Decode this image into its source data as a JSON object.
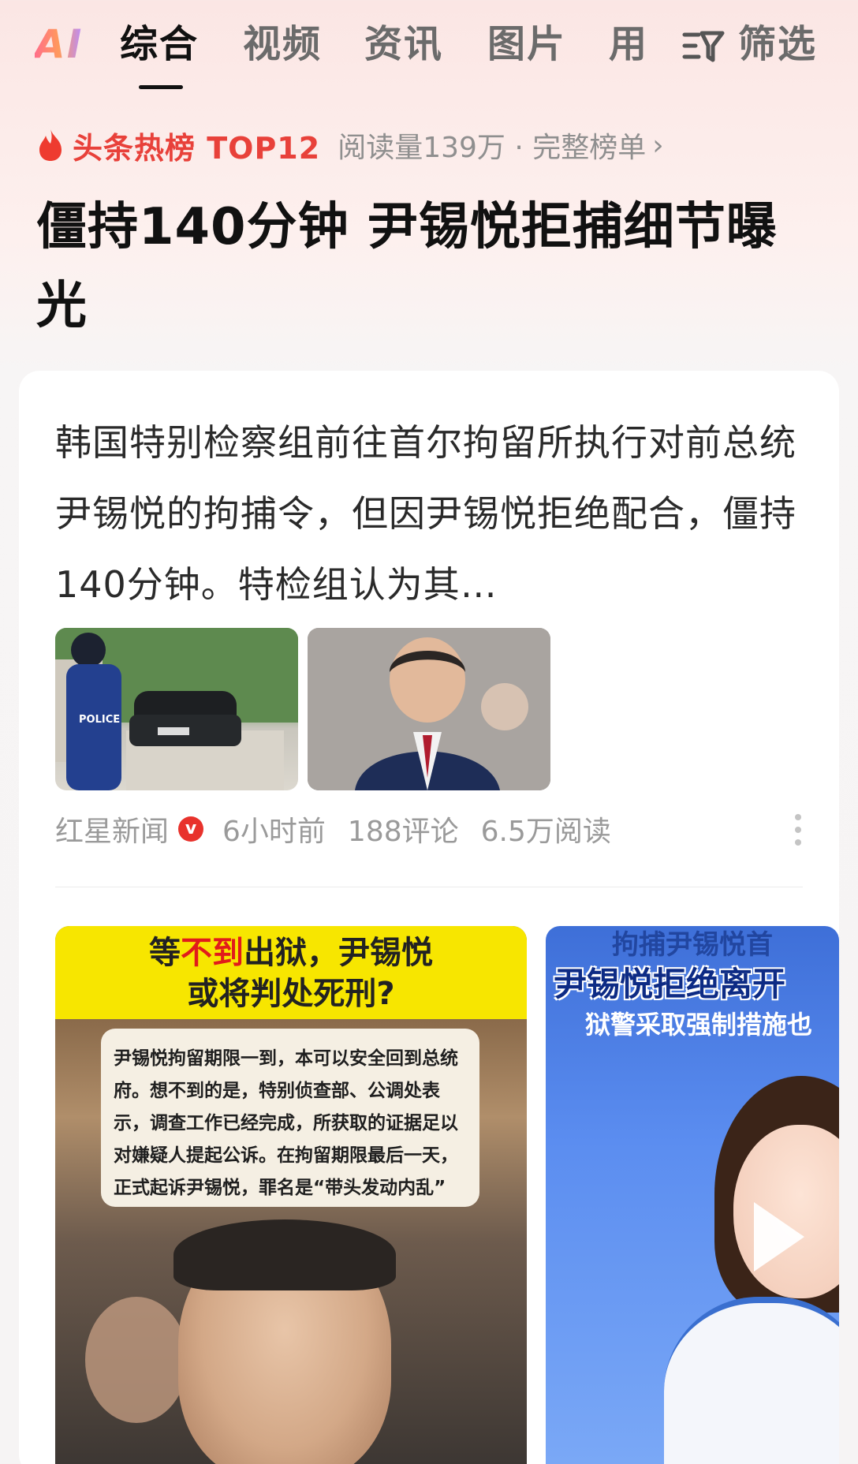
{
  "tabs": {
    "ai": "AI",
    "items": [
      "综合",
      "视频",
      "资讯",
      "图片",
      "用"
    ],
    "active_index": 0,
    "filter_label": "筛选"
  },
  "hot": {
    "label": "头条热榜 TOP12",
    "stats": "阅读量139万 · 完整榜单",
    "chevron": "›"
  },
  "headline": "僵持140分钟 尹锡悦拒捕细节曝光",
  "article": {
    "summary": "韩国特别检察组前往首尔拘留所执行对前总统尹锡悦的拘捕令，但因尹锡悦拒绝配合，僵持140分钟。特检组认为其…",
    "source": "红星新闻",
    "verified_mark": "v",
    "time": "6小时前",
    "comments": "188评论",
    "reads": "6.5万阅读"
  },
  "image1": {
    "banner_line1_a": "等",
    "banner_line1_b": "不到",
    "banner_line1_c": "出狱，尹锡悦",
    "banner_line2": "或将判处死刑?",
    "quote": "尹锡悦拘留期限一到，本可以安全回到总统府。想不到的是，特别侦查部、公调处表示，调查工作已经完成，所获取的证据足以对嫌疑人提起公诉。在拘留期限最后一天，正式起诉尹锡悦，罪名是“带头发动内乱”"
  },
  "image2": {
    "title_top": "拘捕尹锡悦首",
    "title_main": "尹锡悦拒绝离开",
    "title_sub": "狱警采取强制措施也"
  },
  "colors": {
    "accent_red": "#e8413a",
    "banner_yellow": "#f7e600",
    "video_blue": "#3e6fd8"
  },
  "icons": [
    "flame-icon",
    "filter-icon",
    "chevron-right-icon",
    "verified-icon",
    "more-icon",
    "play-icon"
  ]
}
